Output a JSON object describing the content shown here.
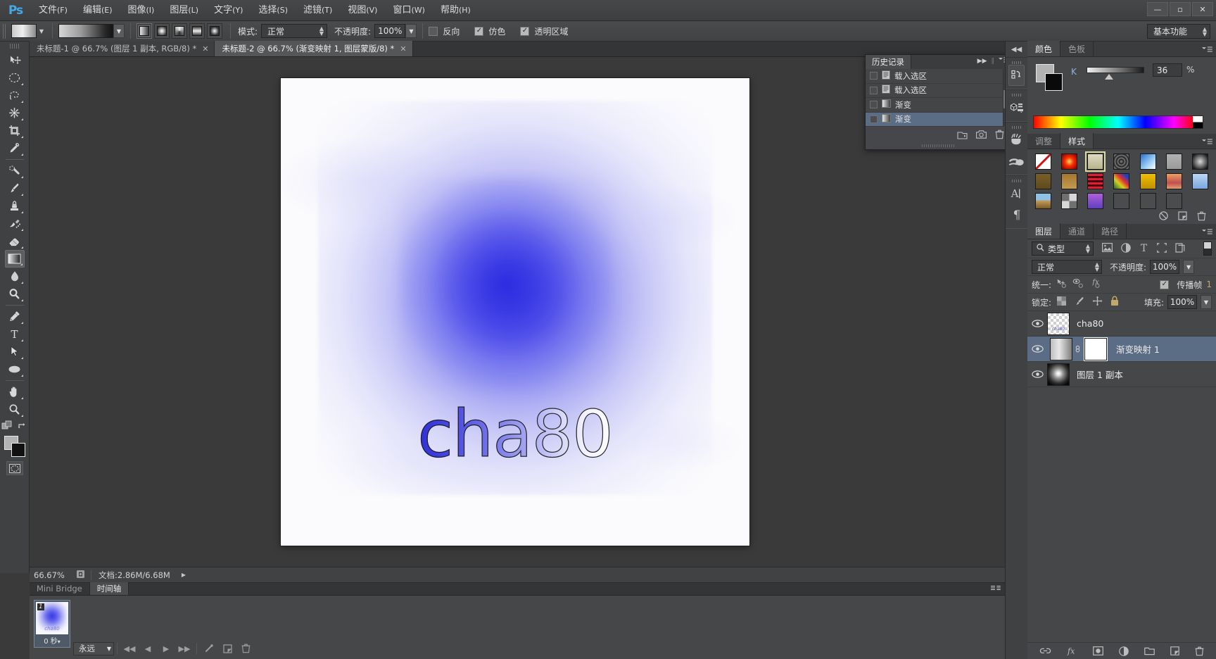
{
  "app": {
    "logo": "Ps",
    "workspace": "基本功能"
  },
  "menubar": {
    "items": [
      {
        "label": "文件",
        "mnemonic": "(F)"
      },
      {
        "label": "编辑",
        "mnemonic": "(E)"
      },
      {
        "label": "图像",
        "mnemonic": "(I)"
      },
      {
        "label": "图层",
        "mnemonic": "(L)"
      },
      {
        "label": "文字",
        "mnemonic": "(Y)"
      },
      {
        "label": "选择",
        "mnemonic": "(S)"
      },
      {
        "label": "滤镜",
        "mnemonic": "(T)"
      },
      {
        "label": "视图",
        "mnemonic": "(V)"
      },
      {
        "label": "窗口",
        "mnemonic": "(W)"
      },
      {
        "label": "帮助",
        "mnemonic": "(H)"
      }
    ]
  },
  "window_controls": {
    "minimize": "—",
    "maximize": "▫",
    "close": "✕"
  },
  "options_bar": {
    "mode_label": "模式:",
    "mode_value": "正常",
    "opacity_label": "不透明度:",
    "opacity_value": "100%",
    "reverse_label": "反向",
    "reverse_checked": false,
    "dither_label": "仿色",
    "dither_checked": true,
    "transparency_label": "透明区域",
    "transparency_checked": true,
    "gradient_types": [
      "linear-gradient-icon",
      "radial-gradient-icon",
      "angle-gradient-icon",
      "reflected-gradient-icon",
      "diamond-gradient-icon"
    ],
    "gradient_type_active": 0
  },
  "document_tabs": [
    {
      "title": "未标题-1 @ 66.7% (图层 1 副本, RGB/8) *",
      "active": false,
      "close": "✕"
    },
    {
      "title": "未标题-2 @ 66.7% (渐变映射 1, 图层蒙版/8) *",
      "active": true,
      "close": "✕"
    }
  ],
  "toolbar": {
    "tools": [
      {
        "name": "move-tool",
        "active": false
      },
      {
        "name": "marquee-tool",
        "active": false
      },
      {
        "name": "lasso-tool",
        "active": false
      },
      {
        "name": "magic-wand-tool",
        "active": false
      },
      {
        "name": "crop-tool",
        "active": false
      },
      {
        "name": "eyedropper-tool",
        "active": false
      },
      {
        "name": "healing-brush-tool",
        "active": false
      },
      {
        "name": "brush-tool",
        "active": false
      },
      {
        "name": "clone-stamp-tool",
        "active": false
      },
      {
        "name": "history-brush-tool",
        "active": false
      },
      {
        "name": "eraser-tool",
        "active": false
      },
      {
        "name": "gradient-tool",
        "active": true
      },
      {
        "name": "blur-tool",
        "active": false
      },
      {
        "name": "dodge-tool",
        "active": false
      },
      {
        "name": "pen-tool",
        "active": false
      },
      {
        "name": "type-tool",
        "active": false
      },
      {
        "name": "path-selection-tool",
        "active": false
      },
      {
        "name": "ellipse-shape-tool",
        "active": false
      },
      {
        "name": "hand-tool",
        "active": false
      },
      {
        "name": "zoom-tool",
        "active": false
      }
    ],
    "foreground_color": "#b3b3b3",
    "background_color": "#111111"
  },
  "canvas": {
    "artwork_text": "cha80",
    "zoom": "66.67%"
  },
  "status_bar": {
    "zoom": "66.67%",
    "doc_label": "文档:",
    "doc_value": "2.86M/6.68M",
    "arrow": "▶"
  },
  "bottom_panel": {
    "tabs": [
      {
        "label": "Mini Bridge",
        "active": false
      },
      {
        "label": "时间轴",
        "active": true
      }
    ],
    "frames": [
      {
        "number": "1",
        "delay": "0 秒",
        "thumb_text": "cha80"
      }
    ],
    "loop_value": "永远",
    "controls": [
      "first-frame-icon",
      "previous-frame-icon",
      "play-icon",
      "next-frame-icon",
      "tween-icon",
      "duplicate-frame-icon",
      "delete-frame-icon"
    ]
  },
  "history_panel": {
    "tab_label": "历史记录",
    "items": [
      {
        "label": "载入选区",
        "icon": "selection-icon",
        "selected": false
      },
      {
        "label": "载入选区",
        "icon": "selection-icon",
        "selected": false
      },
      {
        "label": "渐变",
        "icon": "gradient-icon",
        "selected": false
      },
      {
        "label": "渐变",
        "icon": "gradient-icon",
        "selected": true
      }
    ],
    "footer_icons": [
      "new-document-from-state-icon",
      "new-snapshot-icon",
      "delete-state-icon"
    ]
  },
  "right_dock_icons": [
    {
      "name": "history-dock-icon",
      "active": true
    },
    {
      "name": "3d-dock-icon",
      "active": false
    },
    {
      "name": "brush-dock-icon",
      "active": false
    },
    {
      "name": "brush-presets-dock-icon",
      "active": false
    },
    {
      "name": "character-dock-icon",
      "active": false
    },
    {
      "name": "paragraph-dock-icon",
      "active": false
    }
  ],
  "color_panel": {
    "tabs": [
      {
        "label": "颜色",
        "active": true
      },
      {
        "label": "色板",
        "active": false
      }
    ],
    "channel_label": "K",
    "channel_value": "36",
    "percent_sign": "%",
    "foreground_color": "#b3b3b3",
    "background_color": "#0a0a0a"
  },
  "styles_panel": {
    "tabs": [
      {
        "label": "调整",
        "active": false
      },
      {
        "label": "样式",
        "active": true
      }
    ],
    "swatches": [
      {
        "name": "none-style",
        "css": "linear-gradient(to bottom right,#ffffff 0%,#ffffff 44%,#d01010 46%,#d01010 54%,#ffffff 56%)",
        "selected": false
      },
      {
        "name": "red-glow-style",
        "css": "radial-gradient(circle,#ffd060 4%,#ff3000 40%,#8a0000 95%)",
        "selected": false
      },
      {
        "name": "beveled-frame-style",
        "css": "linear-gradient(#dedac0,#b9b48e)",
        "selected": true
      },
      {
        "name": "spiral-style",
        "css": "repeating-radial-gradient(circle,#6b6b6b 0 2px,#2e2e2e 2px 4px)",
        "selected": false
      },
      {
        "name": "blue-sky-style",
        "css": "linear-gradient(135deg,#2a6fd0,#9ed0f5 60%,#ffffff)",
        "selected": false
      },
      {
        "name": "gray-style",
        "css": "linear-gradient(#b2b2b2,#9a9a9a)",
        "selected": false
      },
      {
        "name": "dark-vignette-style",
        "css": "radial-gradient(circle,#cfcfcf 5%,#1c1c1c 85%)",
        "selected": false
      },
      {
        "name": "brown-style",
        "css": "linear-gradient(#7a5e28,#5e4a20)",
        "selected": false
      },
      {
        "name": "tan-style",
        "css": "linear-gradient(#a3772e,#c49a52)",
        "selected": false
      },
      {
        "name": "red-stripe-style",
        "css": "repeating-linear-gradient(#e02030 0 3px,#4a0010 3px 6px)",
        "selected": false
      },
      {
        "name": "rainbow-swirl-style",
        "css": "linear-gradient(45deg,#1d6b2e,#d8d020 35%,#e03030 60%,#2040c0 85%)",
        "selected": false
      },
      {
        "name": "yellow-box-style",
        "css": "linear-gradient(#f0c000,#c09000)",
        "selected": false
      },
      {
        "name": "sunset-style",
        "css": "linear-gradient(#f0a060,#c05050 60%,#e0a070)",
        "selected": false
      },
      {
        "name": "light-blue-style",
        "css": "linear-gradient(#bcd6f5,#7aa6e0)",
        "selected": false
      },
      {
        "name": "landscape-style",
        "css": "linear-gradient(#8ec0e8 0 45%,#c8a060 45%,#7a5a28)",
        "selected": false
      },
      {
        "name": "noise-style",
        "css": "repeating-conic-gradient(#d8d8d8 0 25%,#707070 0 50%)",
        "selected": false
      },
      {
        "name": "purple-gradient-style",
        "css": "linear-gradient(#b060d8,#6040c0)",
        "selected": false
      },
      {
        "name": "empty-style-1",
        "css": "#4a4c4e",
        "selected": false
      },
      {
        "name": "empty-style-2",
        "css": "#4a4c4e",
        "selected": false
      },
      {
        "name": "empty-style-3",
        "css": "#4a4c4e",
        "selected": false
      },
      {
        "name": "empty-style-4",
        "css": "transparent",
        "selected": false
      }
    ],
    "footer_icons": [
      "clear-style-icon",
      "new-style-icon",
      "delete-style-icon"
    ]
  },
  "layers_panel": {
    "tabs": [
      {
        "label": "图层",
        "active": true
      },
      {
        "label": "通道",
        "active": false
      },
      {
        "label": "路径",
        "active": false
      }
    ],
    "filter_label": "类型",
    "filter_icons": [
      "pixel-filter-icon",
      "adjustment-filter-icon",
      "type-filter-icon",
      "shape-filter-icon",
      "smart-object-filter-icon"
    ],
    "blend_mode": "正常",
    "opacity_label": "不透明度:",
    "opacity_value": "100%",
    "unify_label": "统一:",
    "unify_icons": [
      "unify-position-icon",
      "unify-visibility-icon",
      "unify-style-icon"
    ],
    "propagate_label": "传播帧",
    "propagate_suffix": "1",
    "propagate_checked": true,
    "lock_label": "锁定:",
    "lock_icons": [
      "lock-transparency-icon",
      "lock-image-icon",
      "lock-position-icon",
      "lock-all-icon"
    ],
    "fill_label": "填充:",
    "fill_value": "100%",
    "layers": [
      {
        "name": "cha80",
        "visible": true,
        "selected": false,
        "thumb": "transparent-text-thumb",
        "has_mask": false
      },
      {
        "name": "渐变映射 1",
        "visible": true,
        "selected": true,
        "thumb": "gradient-map-thumb",
        "has_mask": true,
        "link": "link-icon"
      },
      {
        "name": "图层 1 副本",
        "visible": true,
        "selected": false,
        "thumb": "radial-glow-thumb",
        "has_mask": false
      }
    ],
    "footer_icons": [
      "link-layers-icon",
      "layer-style-icon",
      "add-mask-icon",
      "new-adjustment-icon",
      "new-group-icon",
      "new-layer-icon",
      "delete-layer-icon"
    ]
  }
}
